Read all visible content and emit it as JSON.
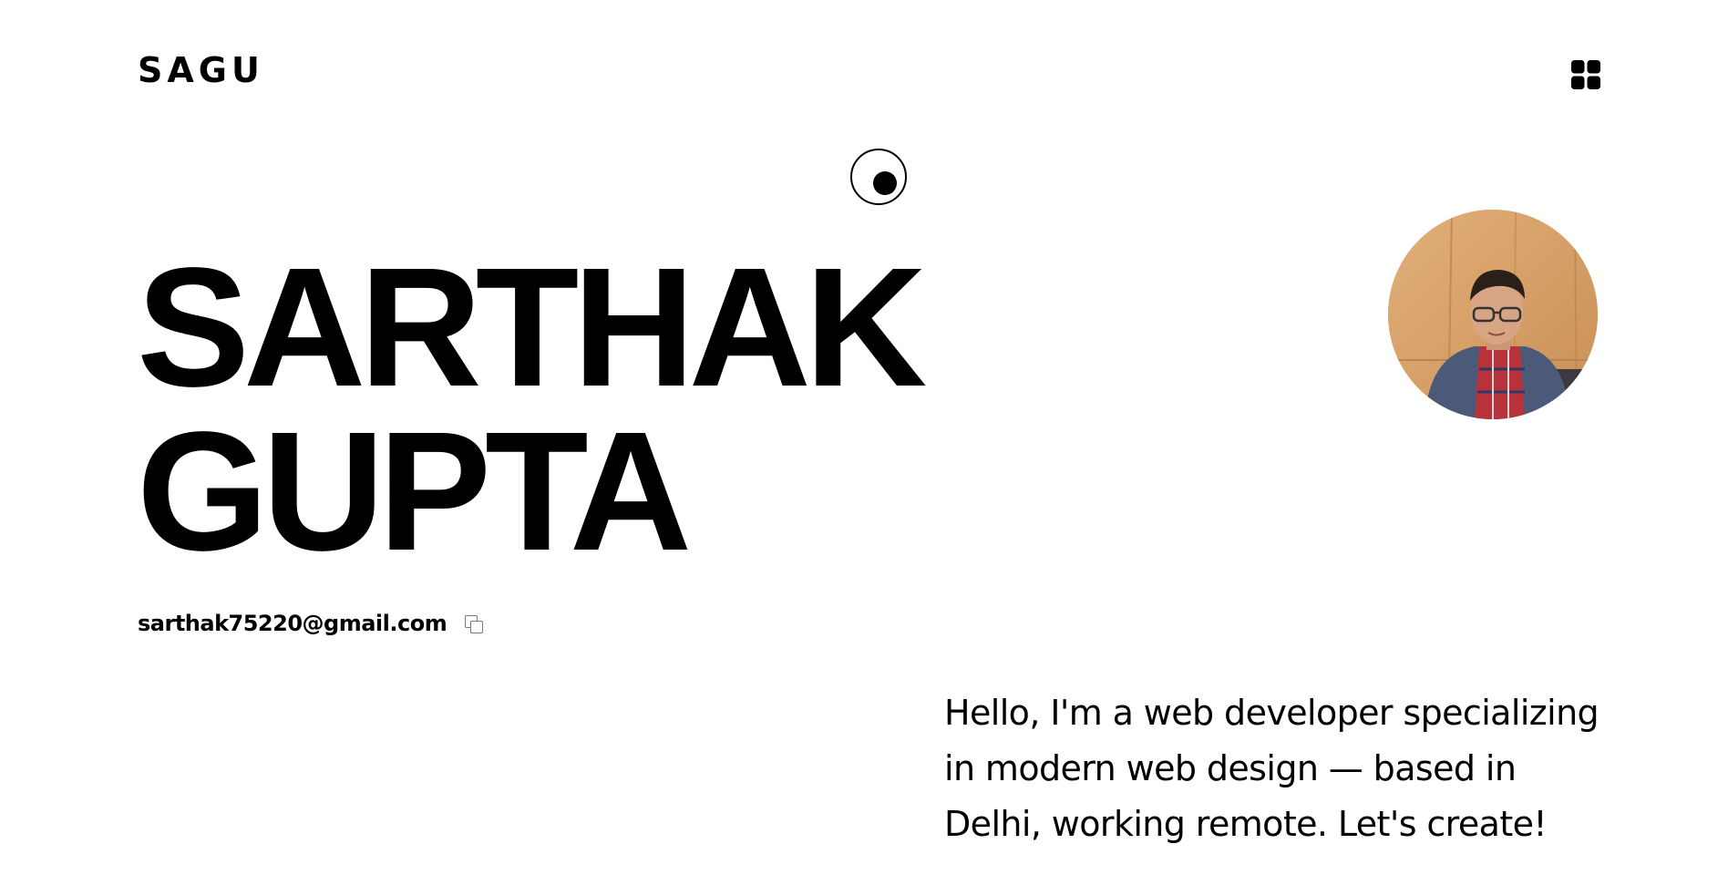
{
  "header": {
    "logo_text": "SAGU",
    "menu_icon": "grid-icon"
  },
  "cursor": {
    "icon": "custom-cursor"
  },
  "hero": {
    "name_line1": "SARTHAK",
    "name_line2": "GUPTA",
    "avatar": "profile-photo"
  },
  "contact": {
    "email": "sarthak75220@gmail.com",
    "copy_icon": "copy-icon"
  },
  "intro": {
    "text": "Hello, I'm a web developer specializing in modern web design — based in Delhi, working remote. Let's create!"
  },
  "colors": {
    "background": "#ffffff",
    "text": "#000000",
    "icon_muted": "#777777"
  }
}
